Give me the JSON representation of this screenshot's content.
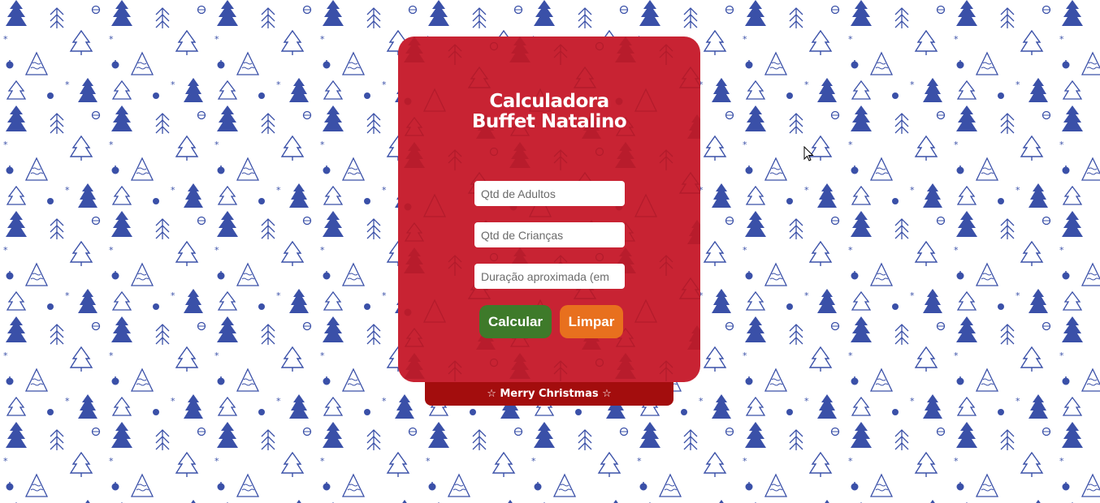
{
  "app": {
    "title_line1": "Calculadora",
    "title_line2": "Buffet Natalino"
  },
  "form": {
    "adultos_placeholder": "Qtd de Adultos",
    "criancas_placeholder": "Qtd de Crianças",
    "duracao_placeholder": "Duração aproximada (em"
  },
  "actions": {
    "calcular_label": "Calcular",
    "limpar_label": "Limpar"
  },
  "footer": {
    "text": "☆ Merry Christmas ☆"
  },
  "colors": {
    "card": "#c82333",
    "footer": "#a30d0d",
    "calcular": "#3e7a2a",
    "limpar": "#e8701e",
    "pattern": "#3a50a8"
  },
  "icons": {
    "background": "christmas-tree-pattern",
    "cursor": "mouse-pointer-icon"
  }
}
